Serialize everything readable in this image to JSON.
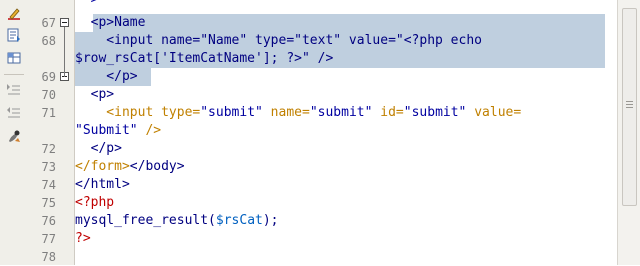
{
  "toolbar": {
    "icons": [
      "pencil-icon",
      "document-list-icon",
      "grid-icon",
      "indent-icon",
      "outdent-icon",
      "format-brush-icon"
    ]
  },
  "gutter": {
    "lines": [
      {
        "label": "67",
        "fold": true
      },
      {
        "label": "68"
      },
      {
        "label": ""
      },
      {
        "label": "69",
        "fold": true
      },
      {
        "label": "70"
      },
      {
        "label": "71"
      },
      {
        "label": ""
      },
      {
        "label": "72"
      },
      {
        "label": "73"
      },
      {
        "label": "74"
      },
      {
        "label": "75"
      },
      {
        "label": "76"
      },
      {
        "label": "77"
      },
      {
        "label": "78"
      }
    ]
  },
  "colors": {
    "tag": "#000080",
    "attr": "#c08000",
    "string": "#0000a0",
    "php": "#c00000",
    "variable": "#0060c0",
    "selection": "#bfcfdf"
  },
  "code": {
    "partial_top": "\"\">",
    "lines": [
      [
        {
          "t": "  <p>Name",
          "c": "tag"
        }
      ],
      [
        {
          "t": "    <input name=\"Name\" type=\"text\" value=\"<?php echo",
          "c": "tag"
        }
      ],
      [
        {
          "t": "$row_rsCat['ItemCatName']; ?>\" />",
          "c": "tag"
        }
      ],
      [
        {
          "t": "    </p>",
          "c": "tag"
        }
      ],
      [
        {
          "t": "  <p>",
          "c": "tag"
        }
      ],
      [
        {
          "t": "    <input type=",
          "c": "attr"
        },
        {
          "t": "\"submit\"",
          "c": "string"
        },
        {
          "t": " name=",
          "c": "attr"
        },
        {
          "t": "\"submit\"",
          "c": "string"
        },
        {
          "t": " id=",
          "c": "attr"
        },
        {
          "t": "\"submit\"",
          "c": "string"
        },
        {
          "t": " value=",
          "c": "attr"
        }
      ],
      [
        {
          "t": "\"Submit\"",
          "c": "string"
        },
        {
          "t": " />",
          "c": "attr"
        }
      ],
      [
        {
          "t": "  </p>",
          "c": "tag"
        }
      ],
      [
        {
          "t": "</form>",
          "c": "attr"
        },
        {
          "t": "</body>",
          "c": "tag"
        }
      ],
      [
        {
          "t": "</html>",
          "c": "tag"
        }
      ],
      [
        {
          "t": "<?php",
          "c": "php"
        }
      ],
      [
        {
          "t": "mysql_free_result(",
          "c": "tag"
        },
        {
          "t": "$rsCat",
          "c": "variable"
        },
        {
          "t": ");",
          "c": "tag"
        }
      ],
      [
        {
          "t": "?>",
          "c": "php"
        }
      ],
      [
        {
          "t": "",
          "c": "tag"
        }
      ]
    ]
  }
}
